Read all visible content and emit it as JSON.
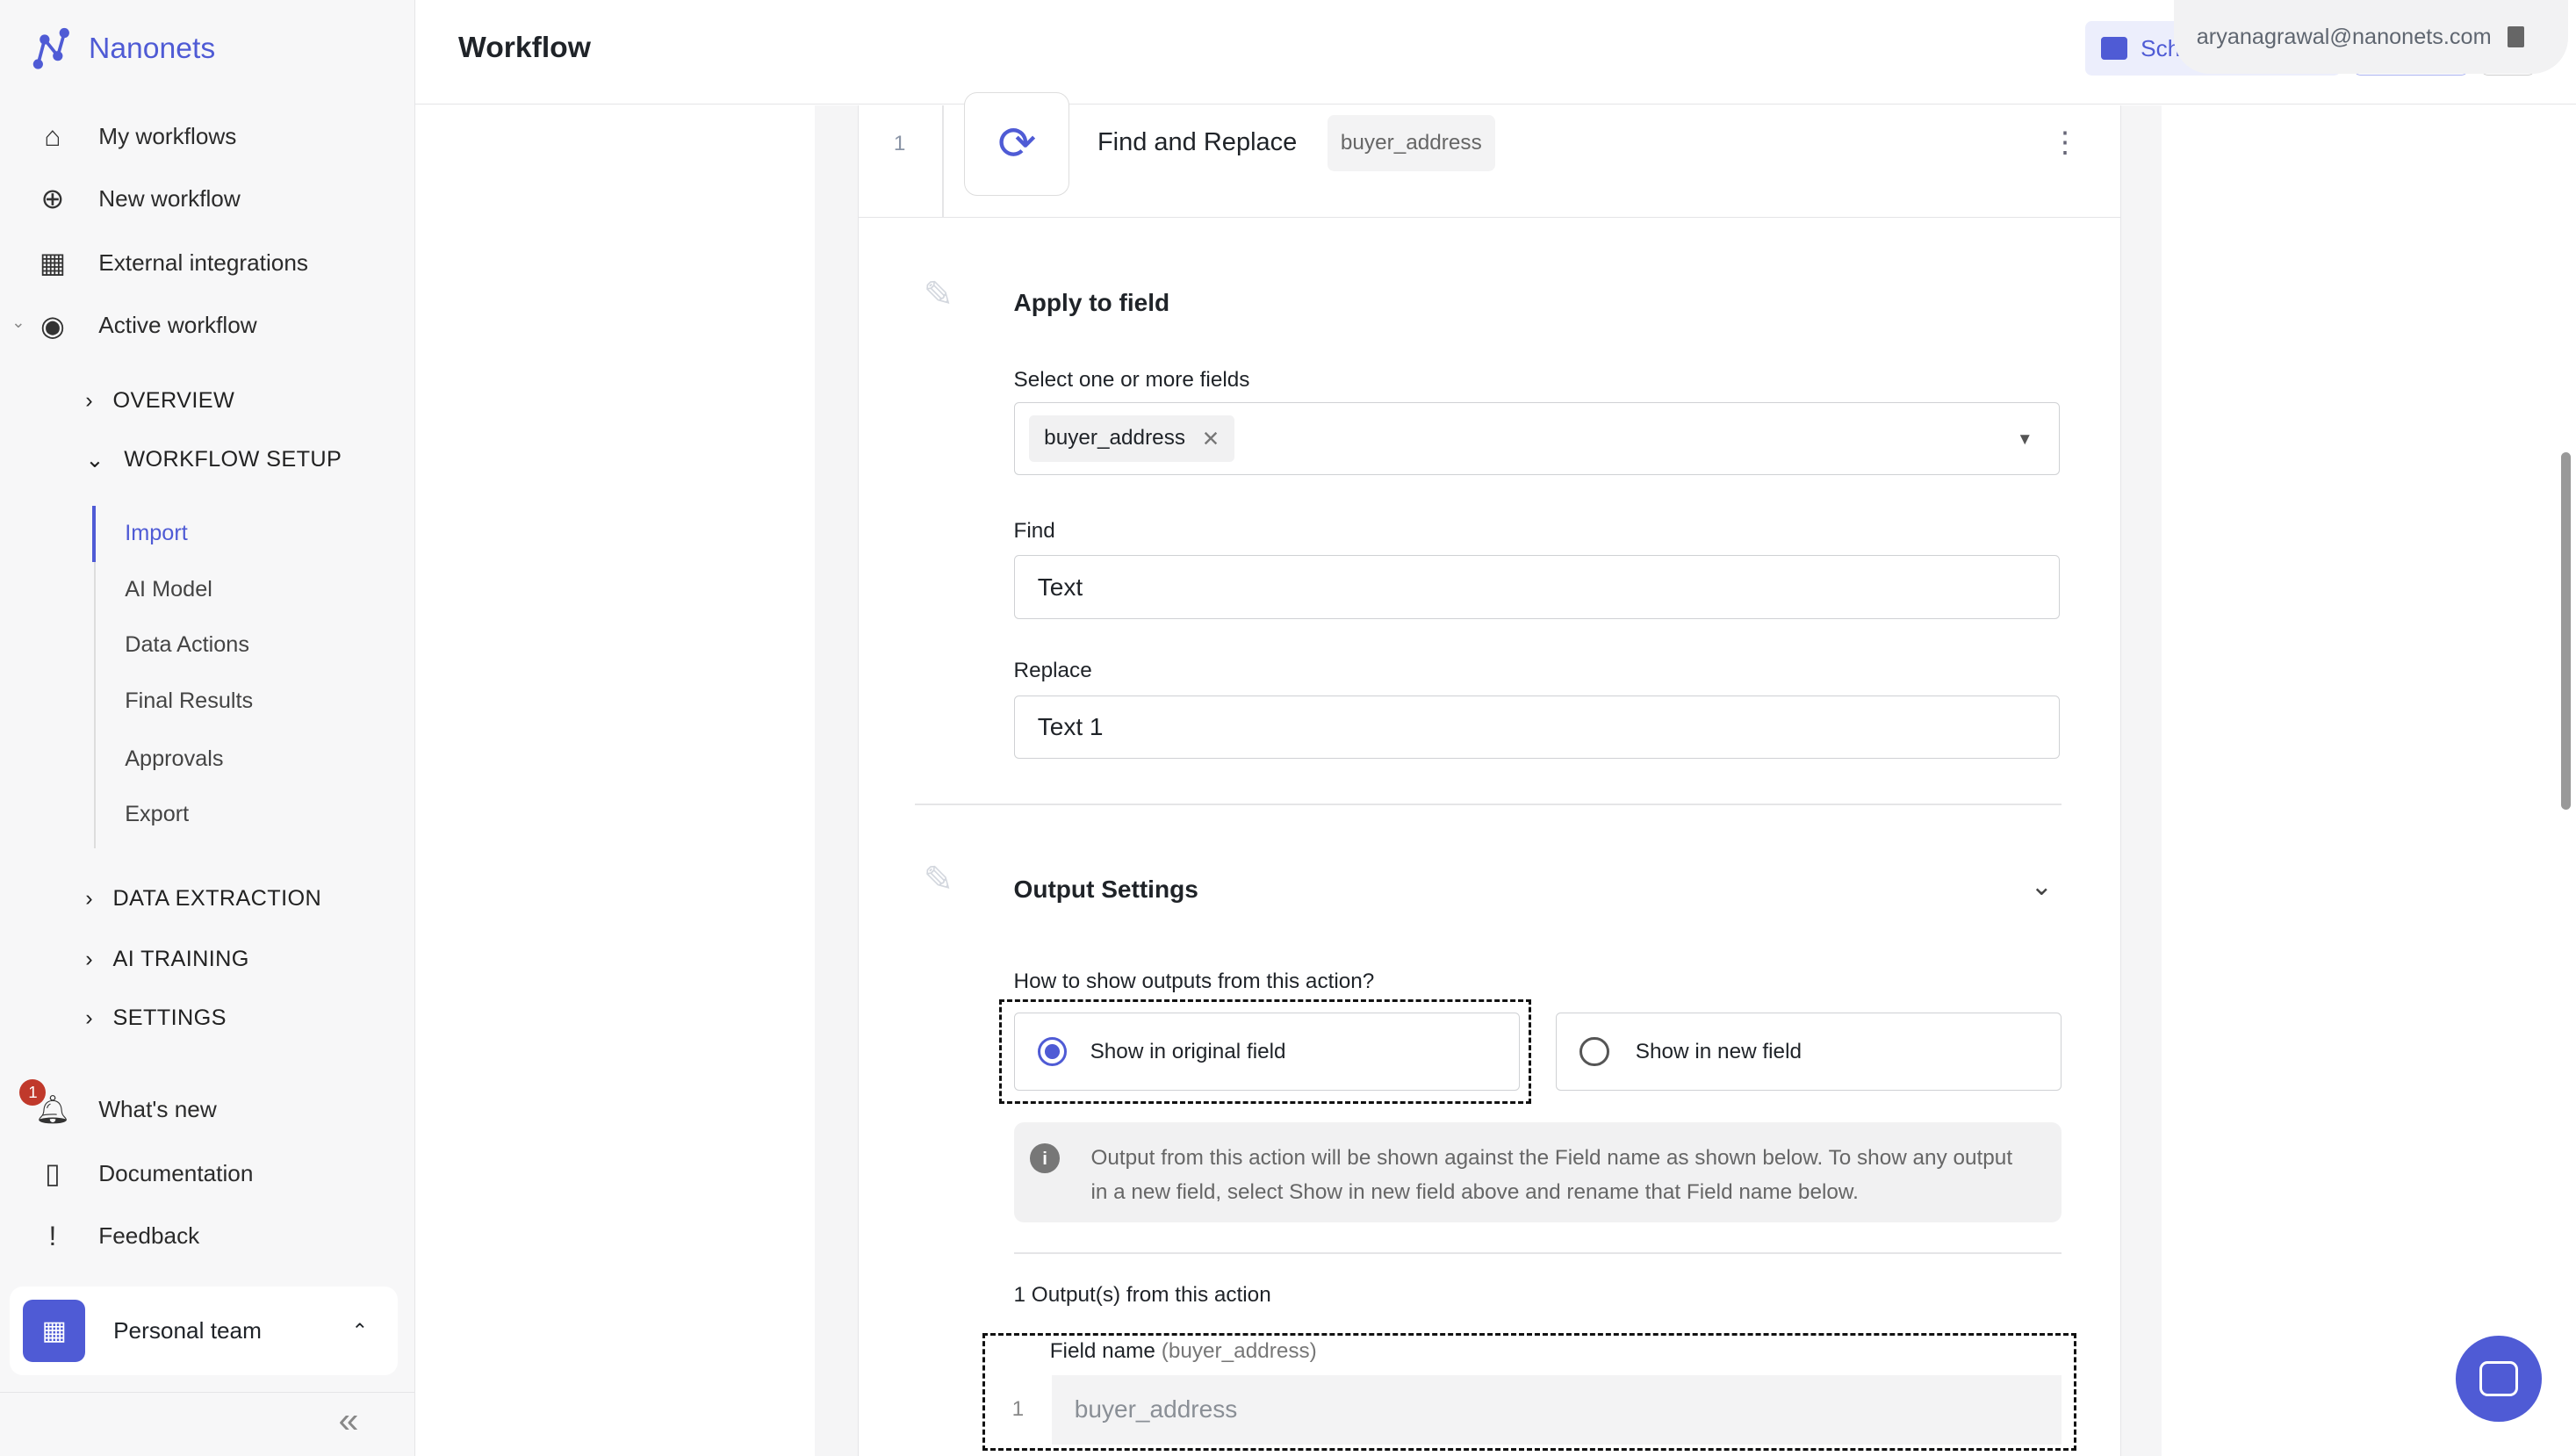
{
  "app": {
    "name": "Nanonets"
  },
  "sidebar": {
    "items": [
      {
        "label": "My workflows",
        "icon": "home-icon"
      },
      {
        "label": "New workflow",
        "icon": "plus-circle-icon"
      },
      {
        "label": "External integrations",
        "icon": "widgets-icon"
      },
      {
        "label": "Active workflow",
        "icon": "compass-icon"
      }
    ],
    "sections": [
      "OVERVIEW",
      "WORKFLOW SETUP",
      "DATA EXTRACTION",
      "AI TRAINING",
      "SETTINGS"
    ],
    "setup_items": [
      "Import",
      "AI Model",
      "Data Actions",
      "Final Results",
      "Approvals",
      "Export"
    ],
    "bottom": [
      {
        "label": "What's new",
        "badge": "1"
      },
      {
        "label": "Documentation"
      },
      {
        "label": "Feedback"
      }
    ],
    "team": "Personal team",
    "accent": "#4f5bd5"
  },
  "header": {
    "title": "Workflow",
    "schedule_label": "Sch",
    "email": "aryanagrawal@nanonets.com"
  },
  "action": {
    "index": "1",
    "title": "Find and Replace",
    "tag": "buyer_address"
  },
  "apply": {
    "title": "Apply to field",
    "select_label": "Select one or more fields",
    "chip": "buyer_address",
    "find_label": "Find",
    "find_value": "Text",
    "replace_label": "Replace",
    "replace_value": "Text 1"
  },
  "output": {
    "title": "Output Settings",
    "question": "How to show outputs from this action?",
    "opt1": "Show in original field",
    "opt2": "Show in new field",
    "selected": "Show in original field",
    "info": "Output from this action will be shown against the Field name as shown below. To show any output in a new field, select Show in new field above and rename that Field name below.",
    "count_label": "1 Output(s) from this action",
    "field_label": "Field name",
    "field_hint": "(buyer_address)",
    "row_index": "1",
    "field_placeholder": "buyer_address"
  }
}
